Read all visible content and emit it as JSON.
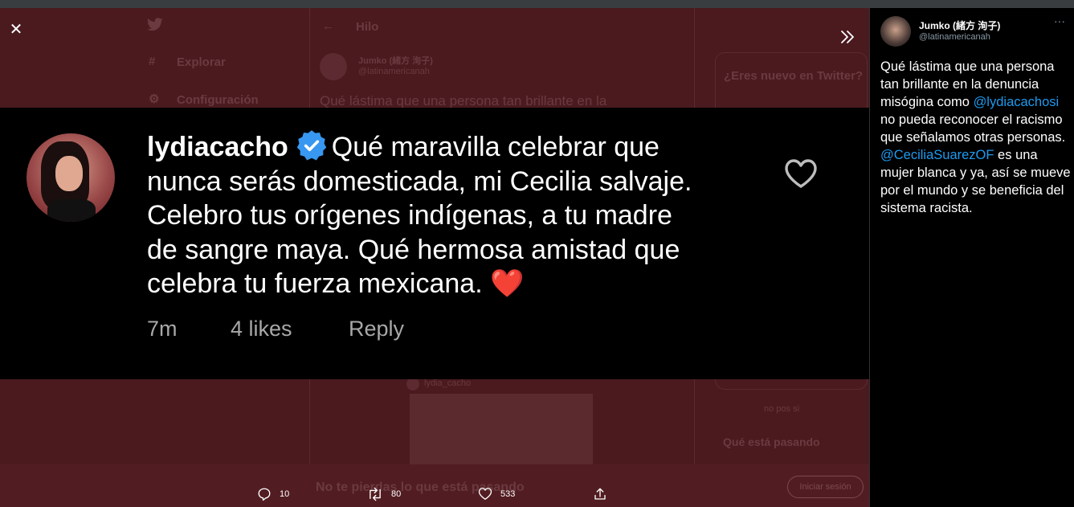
{
  "background": {
    "nav_explore": "Explorar",
    "nav_settings": "Configuración",
    "thread_title": "Hilo",
    "thread_author": "Jumko (緒方 洵子)",
    "thread_handle": "@latinamericanah",
    "thread_text": "Qué lástima que una persona tan brillante en la",
    "side_new": "¿Eres nuevo en Twitter?",
    "side_happening": "Qué está pasando",
    "reply_handle": "lydia_cacho",
    "side_nopos": "no pos si",
    "bottom_banner": "No te pierdas lo que está pasando",
    "bottom_cta": "Iniciar sesión"
  },
  "screenshot": {
    "username": "lydiacacho",
    "text_lines": [
      "Qué maravilla celebrar que",
      "nunca serás domesticada, mi Cecilia salvaje.",
      "Celebro tus orígenes indígenas, a tu madre",
      "de sangre maya. Qué hermosa amistad que",
      "celebra tu fuerza mexicana."
    ],
    "heart_emoji": "❤️",
    "time": "7m",
    "likes": "4 likes",
    "reply": "Reply"
  },
  "actions": {
    "replies": "10",
    "retweets": "80",
    "likes": "533"
  },
  "tweet": {
    "author_name": "Jumko (緒方 洵子)",
    "author_handle": "@latinamericanah",
    "more_icon": "more-dots-icon",
    "body_1": "Qué lástima que una persona tan brillante en la denuncia misógina como ",
    "mention_1": "@lydiacachosi",
    "body_2": " no pueda reconocer el racismo que señalamos otras personas. ",
    "mention_2": "@CeciliaSuarezOF",
    "body_3": " es una mujer blanca y ya, así se mueve por el mundo y se beneficia del sistema racista."
  },
  "colors": {
    "overlay_bg": "#4a1a1f",
    "link": "#1d9bf0",
    "verified": "#3897f0",
    "heart": "#e0101a"
  }
}
